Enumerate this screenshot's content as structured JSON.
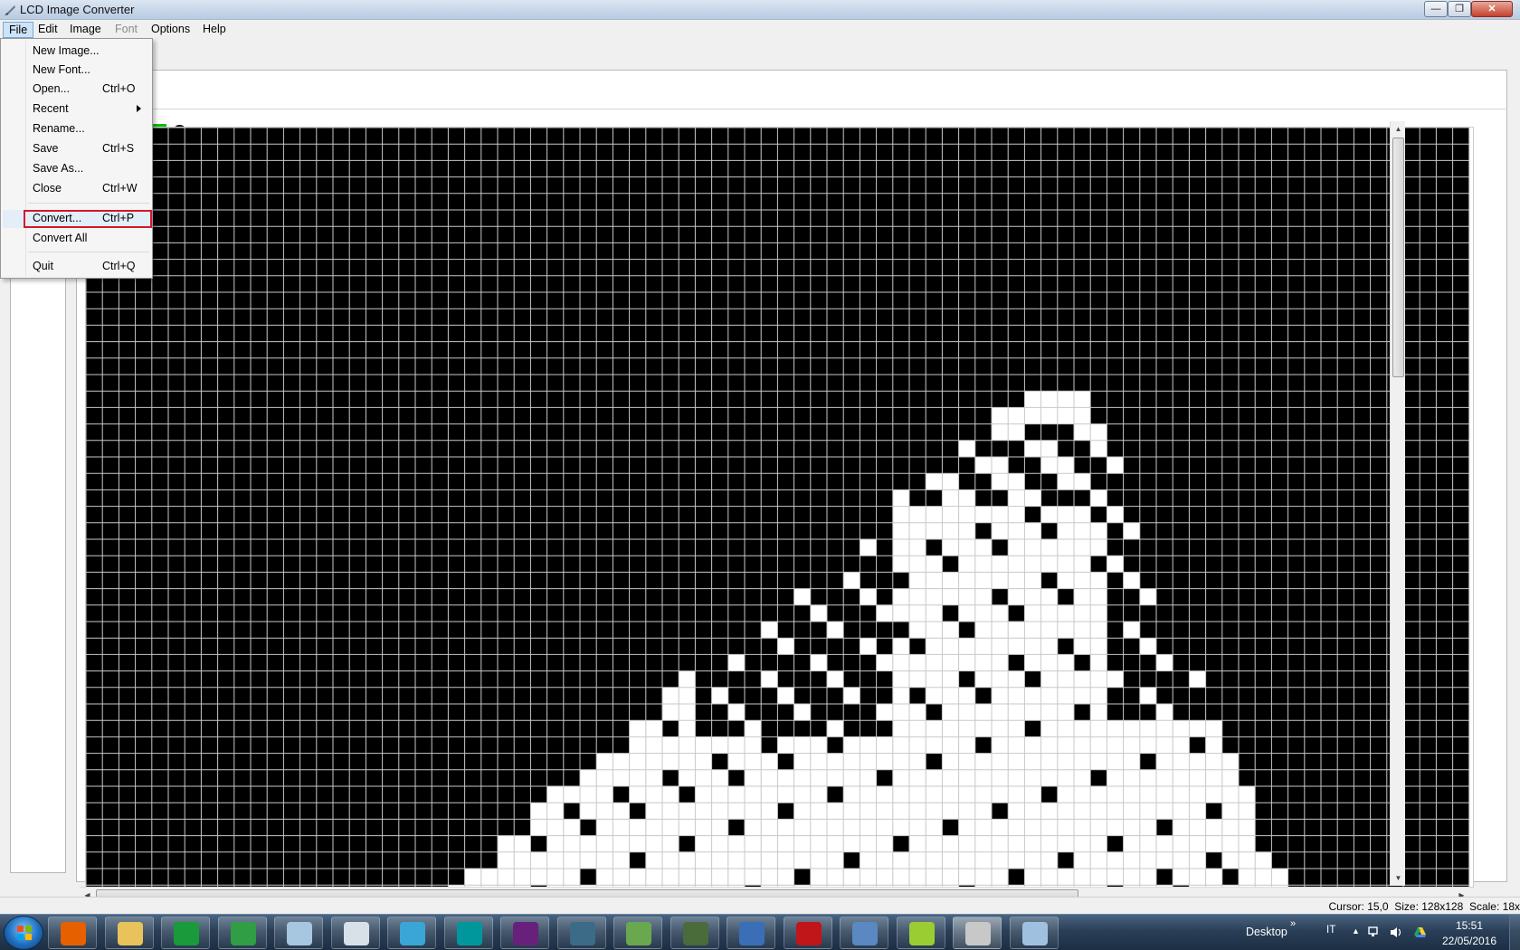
{
  "window": {
    "title": "LCD Image Converter",
    "minimize_glyph": "—",
    "maximize_glyph": "❐",
    "close_glyph": "✕"
  },
  "menubar": {
    "items": [
      "File",
      "Edit",
      "Image",
      "Font",
      "Options",
      "Help"
    ]
  },
  "file_menu": {
    "items": [
      {
        "label": "New Image...",
        "shortcut": ""
      },
      {
        "label": "New Font...",
        "shortcut": ""
      },
      {
        "label": "Open...",
        "shortcut": "Ctrl+O"
      },
      {
        "label": "Recent",
        "shortcut": ""
      },
      {
        "label": "Rename...",
        "shortcut": ""
      },
      {
        "label": "Save",
        "shortcut": "Ctrl+S"
      },
      {
        "label": "Save As...",
        "shortcut": ""
      },
      {
        "label": "Close",
        "shortcut": "Ctrl+W"
      },
      {
        "label": "Convert...",
        "shortcut": "Ctrl+P"
      },
      {
        "label": "Convert All",
        "shortcut": ""
      },
      {
        "label": "Quit",
        "shortcut": "Ctrl+Q"
      }
    ],
    "highlighted": "Convert...",
    "highlight_color": "#d4172a"
  },
  "toolbar": {
    "icons": [
      "color-swatch-icon",
      "search-icon"
    ]
  },
  "editor": {
    "pixel_on_color": "#000000",
    "pixel_off_color": "#ffffff",
    "grid_color": "#c8c8c8"
  },
  "statusbar": {
    "cursor": "Cursor: 15,0",
    "size": "Size: 128x128",
    "scale": "Scale: 18x"
  },
  "taskbar": {
    "apps": [
      {
        "name": "firefox-icon",
        "color": "#e66000"
      },
      {
        "name": "file-explorer-icon",
        "color": "#e8c25a"
      },
      {
        "name": "scope-app-icon",
        "color": "#1a9a3a"
      },
      {
        "name": "chrome-icon",
        "color": "#2f9e44"
      },
      {
        "name": "calculator-icon",
        "color": "#a7c6e0"
      },
      {
        "name": "document-window-icon",
        "color": "#d8e0e8"
      },
      {
        "name": "bird-app-icon",
        "color": "#3aa6d8"
      },
      {
        "name": "arduino-icon",
        "color": "#00979c"
      },
      {
        "name": "visual-studio-icon",
        "color": "#68217a"
      },
      {
        "name": "tree-app-icon",
        "color": "#3b6b86"
      },
      {
        "name": "chart-app-icon",
        "color": "#6aa84f"
      },
      {
        "name": "circuit-board-icon",
        "color": "#4a6b3a"
      },
      {
        "name": "mail-client-icon",
        "color": "#3a6fb8"
      },
      {
        "name": "pdf-reader-icon",
        "color": "#c0161a"
      },
      {
        "name": "image-viewer-icon",
        "color": "#5a88c0"
      },
      {
        "name": "gis-app-icon",
        "color": "#9acd32"
      },
      {
        "name": "lcd-image-converter-icon",
        "color": "#c8c8c8"
      },
      {
        "name": "paint-icon",
        "color": "#a0c0e0"
      }
    ],
    "desktop_label": "Desktop",
    "chevron": "»",
    "language": "IT",
    "up_arrow": "▲",
    "time": "15:51",
    "date": "22/05/2016"
  }
}
